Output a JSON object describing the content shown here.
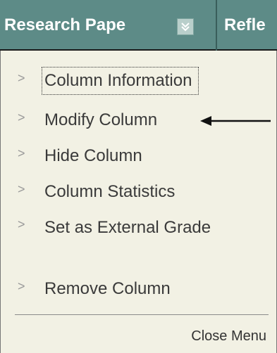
{
  "header": {
    "column1_title": "Research Pape",
    "column2_title": "Refle",
    "dropdown_icon": "double-chevron-down-icon"
  },
  "menu": {
    "items": [
      {
        "label": "Column Information"
      },
      {
        "label": "Modify Column"
      },
      {
        "label": "Hide Column"
      },
      {
        "label": "Column Statistics"
      },
      {
        "label": "Set as External Grade"
      },
      {
        "label": "Remove Column"
      }
    ],
    "close_label": "Close Menu",
    "chevron_icon": "chevron-right-icon"
  },
  "annotation": {
    "pointer": "arrow-left-icon"
  },
  "colors": {
    "header_bg": "#5d8b87",
    "menu_bg": "#f2f1e4",
    "text": "#3a3a3a"
  }
}
